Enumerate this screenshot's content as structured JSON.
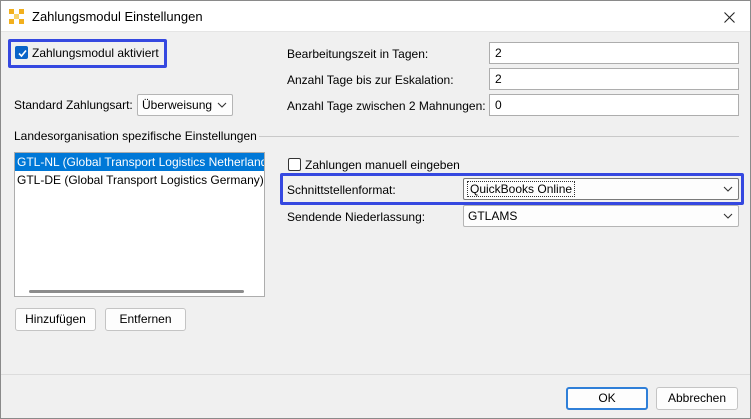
{
  "window": {
    "title": "Zahlungsmodul Einstellungen"
  },
  "general": {
    "module_active_label": "Zahlungsmodul aktiviert",
    "module_active_checked": true,
    "default_payment_label": "Standard Zahlungsart:",
    "default_payment_value": "Überweisung"
  },
  "timing": {
    "processing_days_label": "Bearbeitungszeit in Tagen:",
    "processing_days_value": "2",
    "escalation_days_label": "Anzahl Tage bis zur Eskalation:",
    "escalation_days_value": "2",
    "reminder_days_label": "Anzahl Tage zwischen 2 Mahnungen:",
    "reminder_days_value": "0"
  },
  "country": {
    "section_label": "Landesorganisation spezifische Einstellungen",
    "list": [
      {
        "label": "GTL-NL (Global Transport Logistics Netherland",
        "selected": true
      },
      {
        "label": "GTL-DE (Global Transport Logistics Germany)",
        "selected": false
      }
    ],
    "add_button": "Hinzufügen",
    "remove_button": "Entfernen",
    "manual_entry_label": "Zahlungen manuell eingeben",
    "manual_entry_checked": false,
    "interface_format_label": "Schnittstellenformat:",
    "interface_format_value": "QuickBooks Online",
    "sending_branch_label": "Sendende Niederlassung:",
    "sending_branch_value": "GTLAMS"
  },
  "footer": {
    "ok_button": "OK",
    "cancel_button": "Abbrechen"
  },
  "colors": {
    "highlight": "#3548e0",
    "selection": "#0078d7",
    "checkbox_checked": "#0a64c8",
    "default_button_border": "#2f7fd8"
  }
}
